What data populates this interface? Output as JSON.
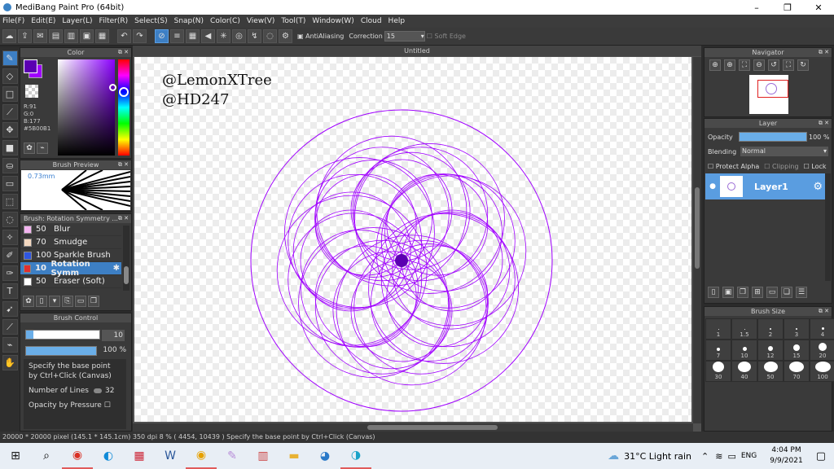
{
  "window": {
    "title": "MediBang Paint Pro (64bit)",
    "minimize": "–",
    "restore": "❐",
    "close": "✕"
  },
  "menu": [
    "File(F)",
    "Edit(E)",
    "Layer(L)",
    "Filter(R)",
    "Select(S)",
    "Snap(N)",
    "Color(C)",
    "View(V)",
    "Tool(T)",
    "Window(W)",
    "Cloud",
    "Help"
  ],
  "toolbar": {
    "antialiasing_label": "AntiAliasing",
    "correction_label": "Correction",
    "correction_value": "15",
    "soft_edge_label": "Soft Edge"
  },
  "color_panel": {
    "title": "Color",
    "r": "R:91",
    "g": "G:0",
    "b": "B:177",
    "hex": "#5B00B1",
    "fg_color": "#5b00b1",
    "accent": "#a000ff"
  },
  "brush_preview": {
    "title": "Brush Preview",
    "size": "0.73mm"
  },
  "brush_list": {
    "title": "Brush: Rotation Symmetry ...",
    "items": [
      {
        "size": "50",
        "name": "Blur",
        "color": "#f3b4f0"
      },
      {
        "size": "70",
        "name": "Smudge",
        "color": "#f5d9c0"
      },
      {
        "size": "100",
        "name": "Sparkle Brush",
        "color": "#2f56e0"
      },
      {
        "size": "10",
        "name": "Rotation Symm",
        "color": "#e02f2f"
      },
      {
        "size": "50",
        "name": "Eraser (Soft)",
        "color": "#ffffff"
      }
    ]
  },
  "brush_control": {
    "title": "Brush Control",
    "size_value": "10",
    "size_fraction": 0.1,
    "opacity_value": "100 %",
    "opacity_fraction": 1.0,
    "hint": "Specify the base point by Ctrl+Click (Canvas)",
    "lines_label": "Number of Lines",
    "lines_value": "32",
    "pressure_label": "Opacity by Pressure"
  },
  "document": {
    "tab": "Untitled",
    "watermark_line1": "@LemonXTree",
    "watermark_line2": "@HD247"
  },
  "navigator": {
    "title": "Navigator"
  },
  "layer_panel": {
    "title": "Layer",
    "opacity_label": "Opacity",
    "opacity_value": "100 %",
    "blending_label": "Blending",
    "blending_value": "Normal",
    "protect_alpha": "Protect Alpha",
    "clipping": "Clipping",
    "lock": "Lock",
    "layer_name": "Layer1"
  },
  "brush_size": {
    "title": "Brush Size",
    "rows": [
      [
        "1",
        "1.5",
        "2",
        "3",
        "4"
      ],
      [
        "7",
        "10",
        "12",
        "15",
        "20"
      ],
      [
        "30",
        "40",
        "50",
        "70",
        "100"
      ]
    ]
  },
  "status": {
    "text": "20000 * 20000 pixel  (145.1 * 145.1cm)  350 dpi  8 %  ( 4454, 10439 )  Specify the base point by Ctrl+Click (Canvas)"
  },
  "taskbar": {
    "weather": "31°C  Light rain",
    "lang": "ENG",
    "time": "4:04 PM",
    "date": "9/9/2021"
  }
}
